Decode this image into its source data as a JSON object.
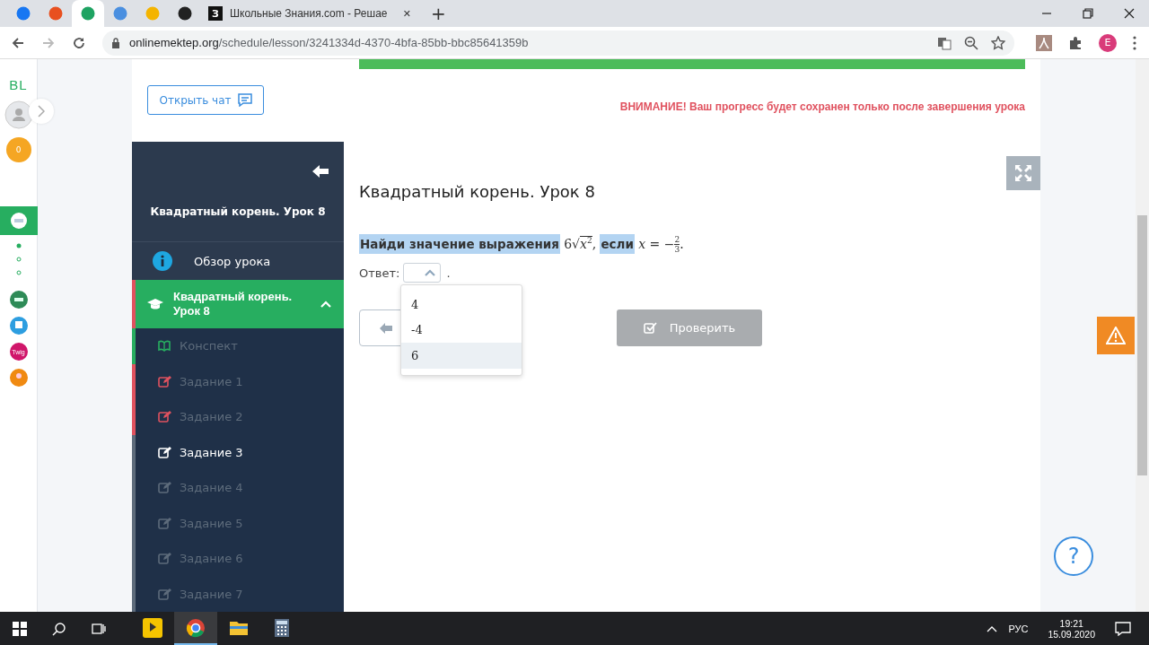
{
  "browser": {
    "tabs": [
      {
        "selected": false,
        "color": "#1877f2"
      },
      {
        "selected": false,
        "color": "#e8501f"
      },
      {
        "selected": true,
        "color": "#1ea362"
      },
      {
        "selected": false,
        "color": "#4a8fe0"
      },
      {
        "selected": false,
        "color": "#f4b400"
      },
      {
        "selected": false,
        "color": "#222222"
      },
      {
        "selected": false,
        "color": "#111111",
        "badge": "З",
        "title": "Школьные Знания.com - Решае",
        "close": "✕"
      }
    ],
    "new_tab": "+",
    "url_host": "onlinemektep.org",
    "url_path": "/schedule/lesson/3241334d-4370-4bfa-85bb-bbc85641359b",
    "profile": "E"
  },
  "rail": {
    "logo": "BL",
    "coins": "0",
    "app_label": "Twig"
  },
  "chat_button": "Открыть чат",
  "sidebar": {
    "title": "Квадратный корень. Урок 8",
    "overview": "Обзор урока",
    "section": {
      "title": "Квадратный корень. Урок 8",
      "expanded": true,
      "children": [
        {
          "kind": "notes",
          "label": "Конспект",
          "color": "#27ae60",
          "selected": false
        },
        {
          "kind": "task",
          "label": "Задание 1",
          "color": "#e0525f",
          "selected": false
        },
        {
          "kind": "task",
          "label": "Задание 2",
          "color": "#e0525f",
          "selected": false
        },
        {
          "kind": "task",
          "label": "Задание 3",
          "color": "#5d6b7b",
          "selected": true
        },
        {
          "kind": "task",
          "label": "Задание 4",
          "color": "#5d6b7b",
          "selected": false
        },
        {
          "kind": "task",
          "label": "Задание 5",
          "color": "#5d6b7b",
          "selected": false
        },
        {
          "kind": "task",
          "label": "Задание 6",
          "color": "#5d6b7b",
          "selected": false
        },
        {
          "kind": "task",
          "label": "Задание 7",
          "color": "#5d6b7b",
          "selected": false
        }
      ]
    }
  },
  "warning": "ВНИМАНИЕ! Ваш прогресс будет сохранен только после завершения урока",
  "lesson_title": "Квадратный корень. Урок 8",
  "question": {
    "lead": {
      "text": "Найди значение выражения",
      "highlighted": true
    },
    "radical": {
      "coef": "6",
      "sign": "√",
      "base": "x",
      "exp": "2"
    },
    "comma": ",",
    "conj": {
      "text": "если",
      "highlighted": true
    },
    "equation": {
      "lhs": "x",
      "op": "=",
      "sign": "−",
      "numerator": "2",
      "denominator": "3"
    },
    "end": "."
  },
  "answer": {
    "label": "Ответ:",
    "after": ".",
    "expanded": true,
    "options": [
      {
        "label": "4",
        "highlighted": false
      },
      {
        "label": "-4",
        "highlighted": false
      },
      {
        "label": "6",
        "highlighted": true
      }
    ]
  },
  "check_button": {
    "label": "Проверить",
    "disabled": true
  },
  "help": "?",
  "taskbar": {
    "apps": [
      {
        "kind": "player",
        "active": false
      },
      {
        "kind": "browser",
        "active": true
      },
      {
        "kind": "folder",
        "active": false
      },
      {
        "kind": "calculator",
        "active": false
      }
    ],
    "lang": "РУС",
    "time": "19:21",
    "date": "15.09.2020"
  }
}
